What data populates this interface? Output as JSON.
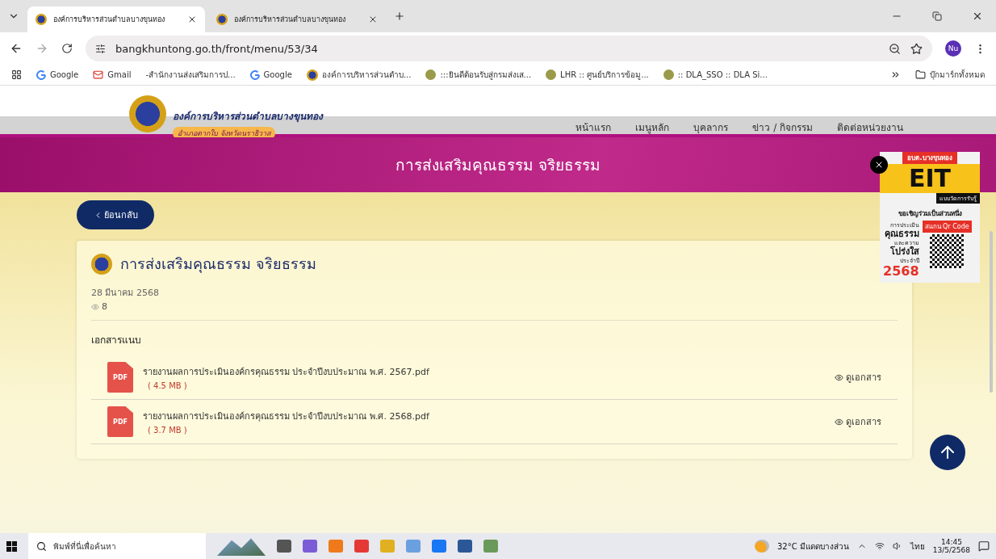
{
  "browser": {
    "tabs": [
      {
        "title": "องค์การบริหารส่วนตำบลบางขุนทอง",
        "selected": true
      },
      {
        "title": "องค์การบริหารส่วนตำบลบางขุนทอง",
        "selected": false
      }
    ],
    "url": "bangkhuntong.go.th/front/menu/53/34",
    "profile": "Nu",
    "bookmarks": [
      {
        "label": "Google",
        "kind": "google"
      },
      {
        "label": "Gmail",
        "kind": "gmail"
      },
      {
        "label": "-สำนักงานส่งเสริมการป...",
        "kind": "none"
      },
      {
        "label": "Google",
        "kind": "google"
      },
      {
        "label": "องค์การบริหารส่วนตำบ...",
        "kind": "seal"
      },
      {
        "label": ":::ยินดีต้อนรับสู่กรมส่งเส...",
        "kind": "emblem"
      },
      {
        "label": "LHR :: ศูนย์บริการข้อมู...",
        "kind": "emblem"
      },
      {
        "label": ":: DLA_SSO :: DLA Si...",
        "kind": "emblem"
      }
    ],
    "all_bookmarks": "บุ๊กมาร์กทั้งหมด"
  },
  "site": {
    "org_name": "องค์การบริหารส่วนตำบลบางขุนทอง",
    "org_subtitle": "อำเภอตากใบ จังหวัดนราธิวาส",
    "nav": [
      "หน้าแรก",
      "เมนูหลัก",
      "บุคลากร",
      "ข่าว / กิจกรรม",
      "ติดต่อหน่วยงาน"
    ],
    "banner_title": "การส่งเสริมคุณธรรม จริยธรรม",
    "back_label": "ย้อนกลับ",
    "post": {
      "title": "การส่งเสริมคุณธรรม จริยธรรม",
      "date": "28 มีนาคม 2568",
      "views": "8",
      "attachments_heading": "เอกสารแนบ",
      "attachments": [
        {
          "type": "PDF",
          "name": "รายงานผลการประเมินองค์กรคุณธรรม ประจำปีงบประมาณ พ.ศ. 2567.pdf",
          "size": "( 4.5 MB )",
          "action": "ดูเอกสาร"
        },
        {
          "type": "PDF",
          "name": "รายงานผลการประเมินองค์กรคุณธรรม ประจำปีงบประมาณ พ.ศ. 2568.pdf",
          "size": "( 3.7 MB )",
          "action": "ดูเอกสาร"
        }
      ]
    },
    "ad": {
      "ribbon": "อบต.บางขุนทอง",
      "big": "EIT",
      "tag": "แบบวัดการรับรู้",
      "invite": "ขอเชิญร่วมเป็นส่วนหนึ่ง",
      "line1": "การประเมิน",
      "line2": "คุณธรรม",
      "line3": "และความ",
      "line4": "โปร่งใส",
      "scan": "สแกน Qr Code",
      "year_label": "ประจำปี",
      "year": "2568"
    }
  },
  "taskbar": {
    "search_placeholder": "พิมพ์ที่นี่เพื่อค้นหา",
    "weather": "32°C มีแดดบางส่วน",
    "language": "ไทย",
    "time": "14:45",
    "date": "13/5/2568"
  }
}
